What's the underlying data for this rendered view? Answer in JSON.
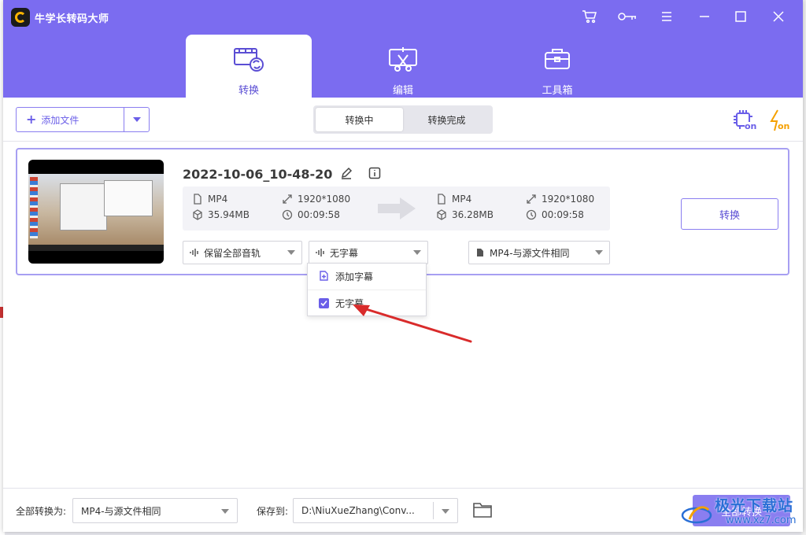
{
  "app": {
    "title": "牛学长转码大师"
  },
  "nav": {
    "tabs": [
      {
        "label": "转换",
        "icon": "film-convert-icon",
        "active": true
      },
      {
        "label": "编辑",
        "icon": "edit-scissors-icon",
        "active": false
      },
      {
        "label": "工具箱",
        "icon": "toolbox-icon",
        "active": false
      }
    ]
  },
  "window_controls": [
    "cart-icon",
    "key-icon",
    "menu-icon",
    "minimize-icon",
    "maximize-icon",
    "close-icon"
  ],
  "toolbar": {
    "add_file_label": "添加文件",
    "segments": [
      {
        "label": "转换中",
        "active": true
      },
      {
        "label": "转换完成",
        "active": false
      }
    ],
    "tools": [
      "gpu-acceleration-icon",
      "fast-convert-icon"
    ],
    "tool_badge": "on"
  },
  "file": {
    "name": "2022-10-06_10-48-20",
    "source": {
      "format": "MP4",
      "resolution": "1920*1080",
      "size": "35.94MB",
      "duration": "00:09:58"
    },
    "target": {
      "format": "MP4",
      "resolution": "1920*1080",
      "size": "36.28MB",
      "duration": "00:09:58"
    },
    "audio_track": "保留全部音轨",
    "subtitle": "无字幕",
    "output_format": "MP4-与源文件相同",
    "convert_label": "转换"
  },
  "subtitle_menu": {
    "items": [
      {
        "label": "添加字幕",
        "icon": "add-subtitle-icon",
        "checked": false
      },
      {
        "label": "无字幕",
        "icon": "checkbox-icon",
        "checked": true
      }
    ]
  },
  "footer": {
    "convert_all_to_label": "全部转换为:",
    "convert_all_to_value": "MP4-与源文件相同",
    "save_to_label": "保存到:",
    "save_to_value": "D:\\NiuXueZhang\\Conv...",
    "convert_all_button": "全部转换"
  },
  "watermark": {
    "text": "极光下载站",
    "url": "www.xz7.com"
  },
  "colors": {
    "accent": "#7b6cf0",
    "accent_dark": "#5b4ed4",
    "annotation": "#d92b2b",
    "flash": "#f5a000"
  }
}
